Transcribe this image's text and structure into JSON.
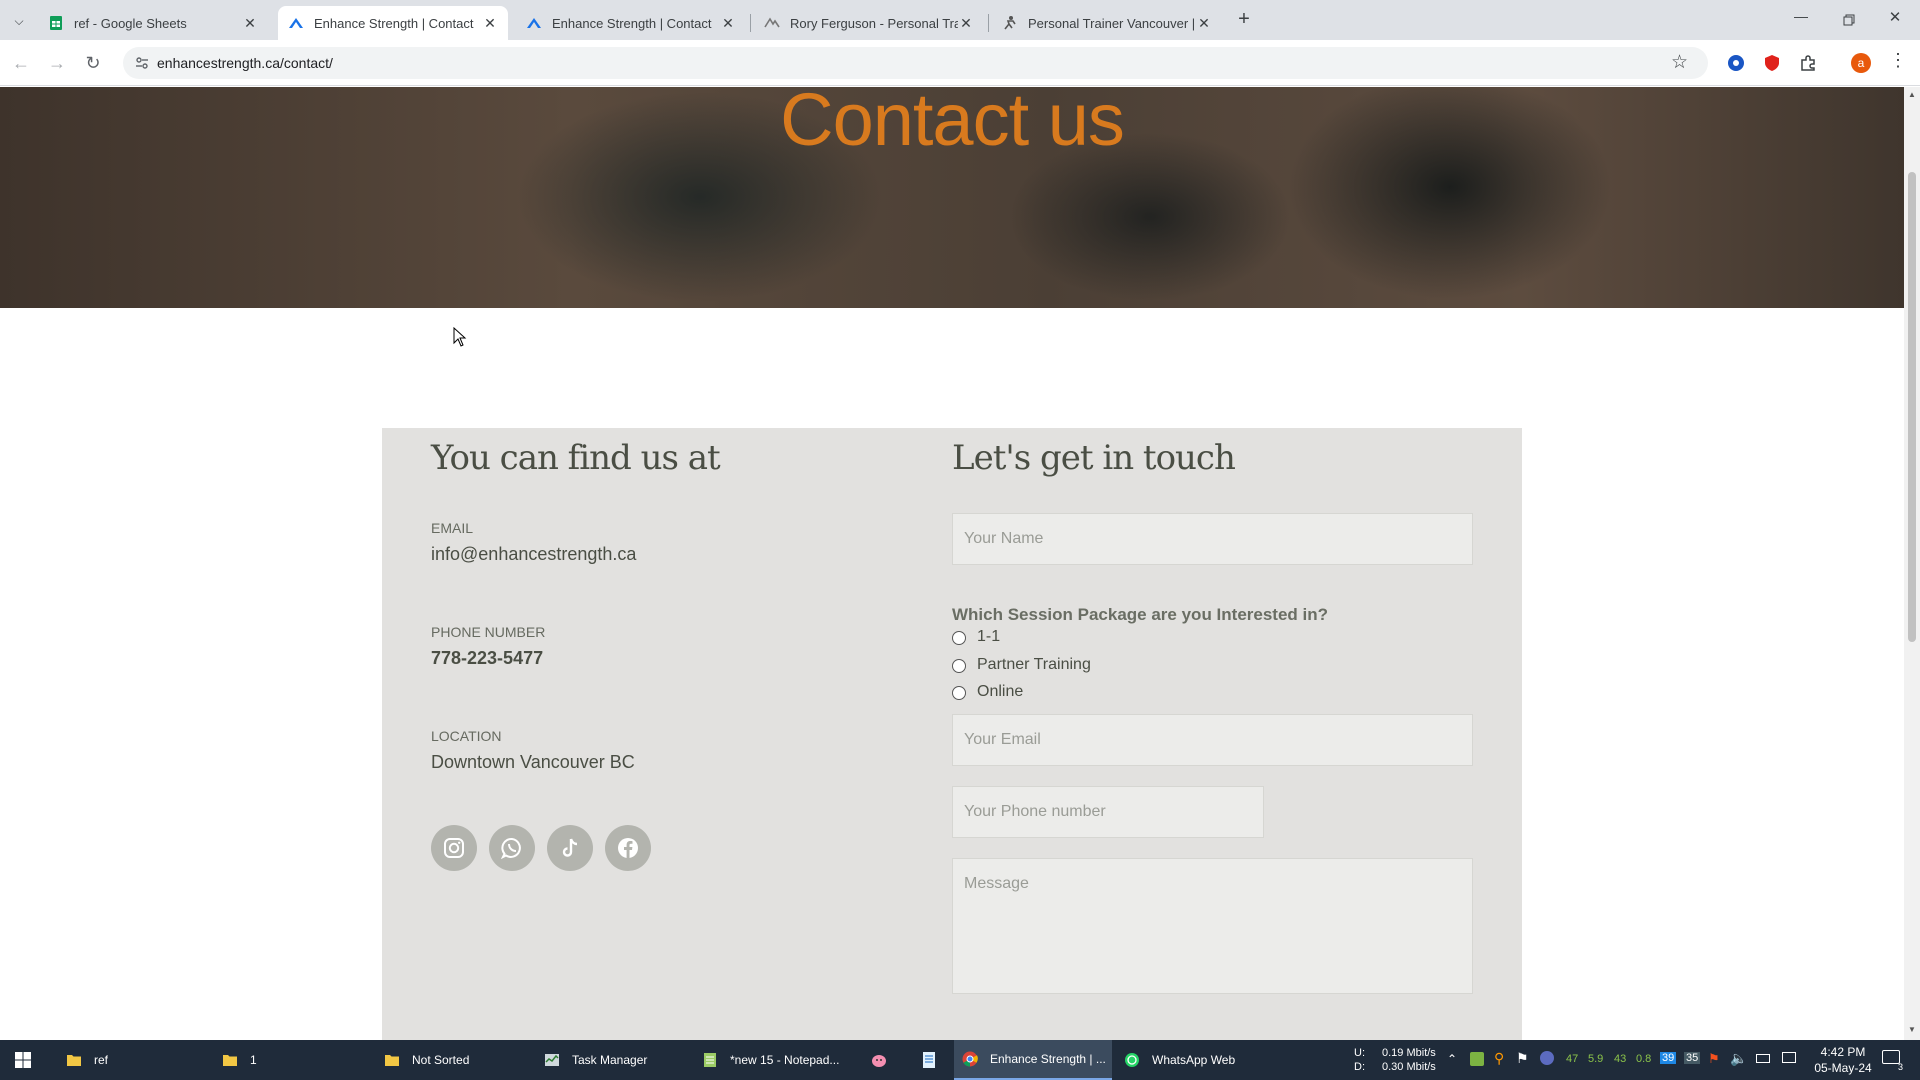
{
  "browser": {
    "tabs": [
      {
        "title": "ref - Google Sheets",
        "active": false
      },
      {
        "title": "Enhance Strength | Contact",
        "active": true
      },
      {
        "title": "Enhance Strength | Contact",
        "active": false
      },
      {
        "title": "Rory Ferguson - Personal Traini",
        "active": false
      },
      {
        "title": "Personal Trainer Vancouver | We",
        "active": false
      }
    ],
    "url": "enhancestrength.ca/contact/",
    "profile_initial": "a",
    "colors": {
      "tabstrip": "#dee1e6",
      "accent": "#1a73e8"
    }
  },
  "page": {
    "hero_title": "Contact us",
    "left": {
      "heading": "You can find us at",
      "email_label": "EMAIL",
      "email_value": "info@enhancestrength.ca",
      "phone_label": "PHONE NUMBER",
      "phone_value": "778-223-5477",
      "location_label": "LOCATION",
      "location_value": "Downtown Vancouver BC",
      "social_icons": [
        "instagram-icon",
        "whatsapp-icon",
        "tiktok-icon",
        "facebook-icon"
      ]
    },
    "right": {
      "heading": "Let's get in touch",
      "name_placeholder": "Your Name",
      "package_question": "Which Session Package are you Interested in?",
      "package_options": [
        "1-1",
        "Partner Training",
        "Online"
      ],
      "email_placeholder": "Your Email",
      "phone_placeholder": "Your Phone number",
      "message_placeholder": "Message"
    },
    "colors": {
      "hero_title": "#d87a1e",
      "card_bg": "#e2e1df",
      "submit": "#f6c52b",
      "heading": "#4a4e44"
    }
  },
  "taskbar": {
    "items": [
      {
        "label": "ref",
        "icon": "folder-icon"
      },
      {
        "label": "1",
        "icon": "folder-icon"
      },
      {
        "label": "Not Sorted",
        "icon": "folder-icon"
      },
      {
        "label": "Task Manager",
        "icon": "task-manager-icon"
      },
      {
        "label": "*new 15 - Notepad...",
        "icon": "notepad-icon"
      },
      {
        "label": "Enhance Strength | ...",
        "icon": "chrome-icon"
      },
      {
        "label": "WhatsApp Web",
        "icon": "whatsapp-icon"
      }
    ],
    "net_up_label": "U:",
    "net_up": "0.19 Mbit/s",
    "net_down_label": "D:",
    "net_down": "0.30 Mbit/s",
    "tray_nums": [
      "47",
      "5.9",
      "43",
      "0.8"
    ],
    "tray_badges": [
      "39",
      "35"
    ],
    "time": "4:42 PM",
    "date": "05-May-24",
    "notifications": "3"
  }
}
